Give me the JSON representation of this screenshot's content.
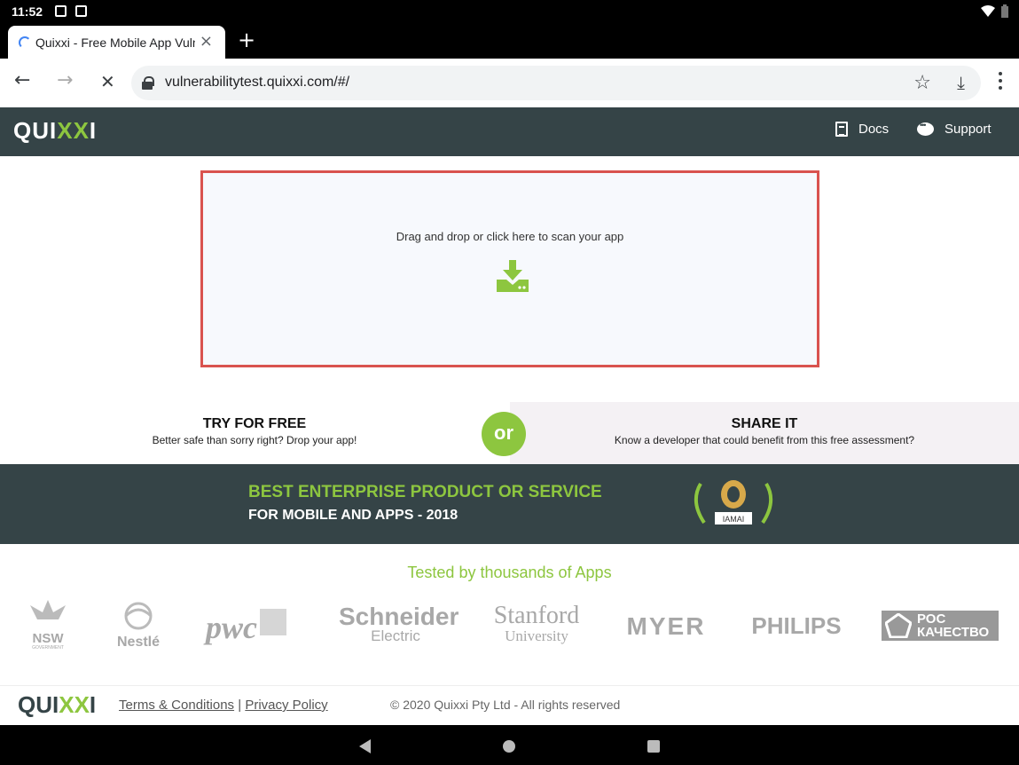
{
  "status_bar": {
    "time": "11:52"
  },
  "browser": {
    "tab_title": "Quixxi - Free Mobile App Vulnerability Test",
    "tab_close": "×",
    "new_tab": "+",
    "url": "vulnerabilitytest.quixxi.com/#/",
    "back": "←",
    "forward": "→",
    "stop": "✕",
    "star": "☆",
    "download": "⤓"
  },
  "header": {
    "logo_prefix": "QUI",
    "logo_accent": "XX",
    "logo_suffix": "I",
    "nav": [
      {
        "label": "Docs",
        "icon": "document-icon"
      },
      {
        "label": "Support",
        "icon": "chat-icon"
      }
    ]
  },
  "dropzone": {
    "label": "Drag and drop or click here to scan your app"
  },
  "cta": {
    "left_title": "TRY FOR FREE",
    "left_sub": "Better safe than sorry right? Drop your app!",
    "or": "or",
    "right_title": "SHARE IT",
    "right_sub": "Know a developer that could benefit from this free assessment?"
  },
  "award": {
    "line1": "BEST ENTERPRISE PRODUCT OR SERVICE",
    "line2": "FOR MOBILE AND APPS - 2018",
    "badge": "IAMAI"
  },
  "clients": {
    "heading": "Tested by thousands of Apps",
    "logos": [
      "NSW",
      "GOVERNMENT",
      "Nestlé",
      "pwc",
      "Schneider",
      "Electric",
      "Stanford",
      "University",
      "MYER",
      "PHILIPS",
      "РОС",
      "КАЧЕСТВО"
    ]
  },
  "footer": {
    "logo_prefix": "QUI",
    "logo_accent": "XX",
    "logo_suffix": "I",
    "terms": "Terms & Conditions",
    "separator": "|",
    "privacy": "Privacy Policy",
    "copyright": "© 2020 Quixxi Pty Ltd - All rights reserved"
  },
  "colors": {
    "brand_dark": "#354447",
    "brand_green": "#8dc63f",
    "dropzone_border": "#d9534f"
  }
}
